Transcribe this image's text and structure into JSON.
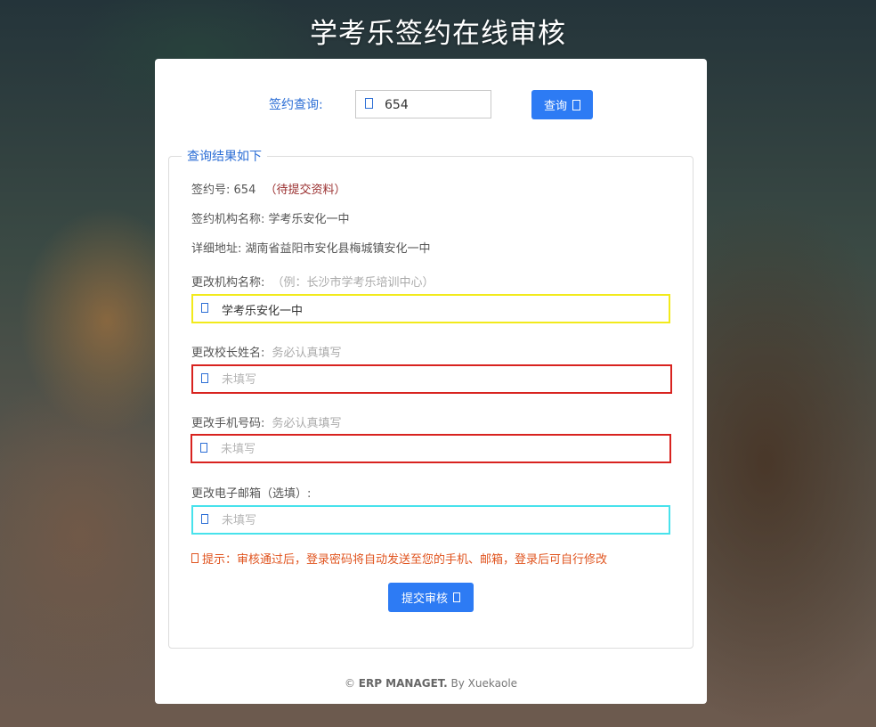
{
  "page": {
    "title": "学考乐签约在线审核"
  },
  "search": {
    "label": "签约查询:",
    "value": "654",
    "button_label": "查询"
  },
  "result": {
    "legend": "查询结果如下",
    "sign_number_label": "签约号:",
    "sign_number": "654",
    "status": "（待提交资料）",
    "org_name_label": "签约机构名称:",
    "org_name": "学考乐安化一中",
    "address_label": "详细地址:",
    "address": "湖南省益阳市安化县梅城镇安化一中"
  },
  "form": {
    "org_name": {
      "label": "更改机构名称:",
      "hint": "（例：长沙市学考乐培训中心）",
      "value": "学考乐安化一中",
      "placeholder": ""
    },
    "principal": {
      "label": "更改校长姓名:",
      "hint": "务必认真填写",
      "value": "",
      "placeholder": "未填写"
    },
    "phone": {
      "label": "更改手机号码:",
      "hint": "务必认真填写",
      "value": "",
      "placeholder": "未填写"
    },
    "email": {
      "label": "更改电子邮箱（选填）:",
      "hint": "",
      "value": "",
      "placeholder": "未填写"
    },
    "tip": "提示：审核通过后，登录密码将自动发送至您的手机、邮箱，登录后可自行修改",
    "submit_label": "提交审核"
  },
  "footer": {
    "copyright": "©",
    "brand": "ERP MANAGET.",
    "by": "By Xuekaole"
  },
  "colors": {
    "accent": "#2d7bf4",
    "label_blue": "#2c6ed5",
    "status_red": "#9a2f2f",
    "tip_orange": "#e0541f",
    "border_yellow": "#f2ea1c",
    "border_red": "#d8231f",
    "border_cyan": "#48e2ec"
  }
}
